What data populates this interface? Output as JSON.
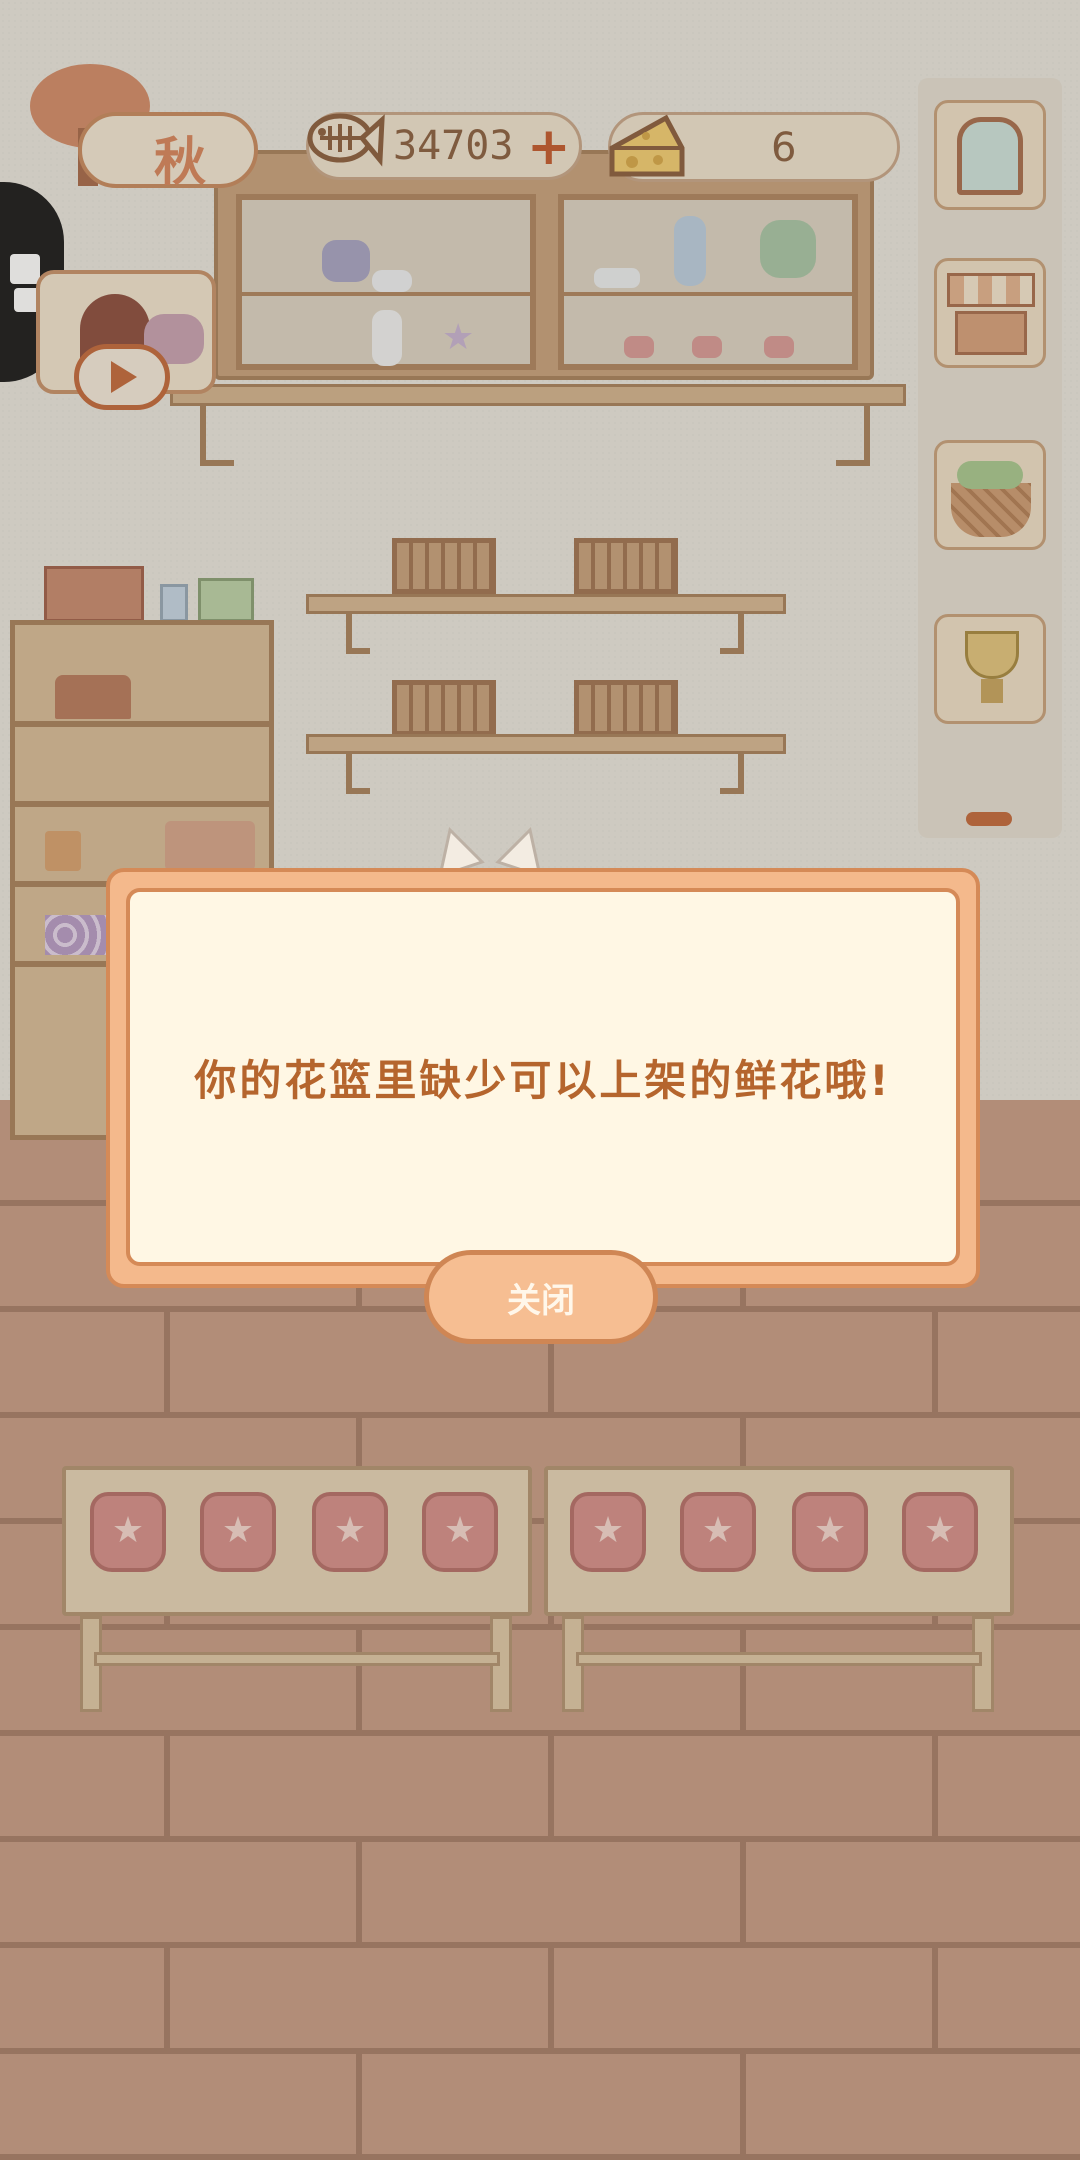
{
  "hud": {
    "season_label": "秋",
    "coins": "34703",
    "coins_plus": "+",
    "cheese": "6"
  },
  "dialog": {
    "message": "你的花篮里缺少可以上架的鲜花哦!",
    "close_label": "关闭"
  },
  "icons": {
    "season": "autumn-tree-icon",
    "coins": "fish-bone-icon",
    "cheese": "cheese-icon",
    "puzzle": "puzzle-icon",
    "play": "play-icon",
    "window": "window-icon",
    "shop": "market-stall-icon",
    "basket": "flower-basket-icon",
    "trophy": "trophy-icon"
  },
  "colors": {
    "accent": "#c4693b",
    "dialog_bg": "#fff7e4",
    "dialog_border": "#d58a57",
    "text": "#b5652d"
  }
}
